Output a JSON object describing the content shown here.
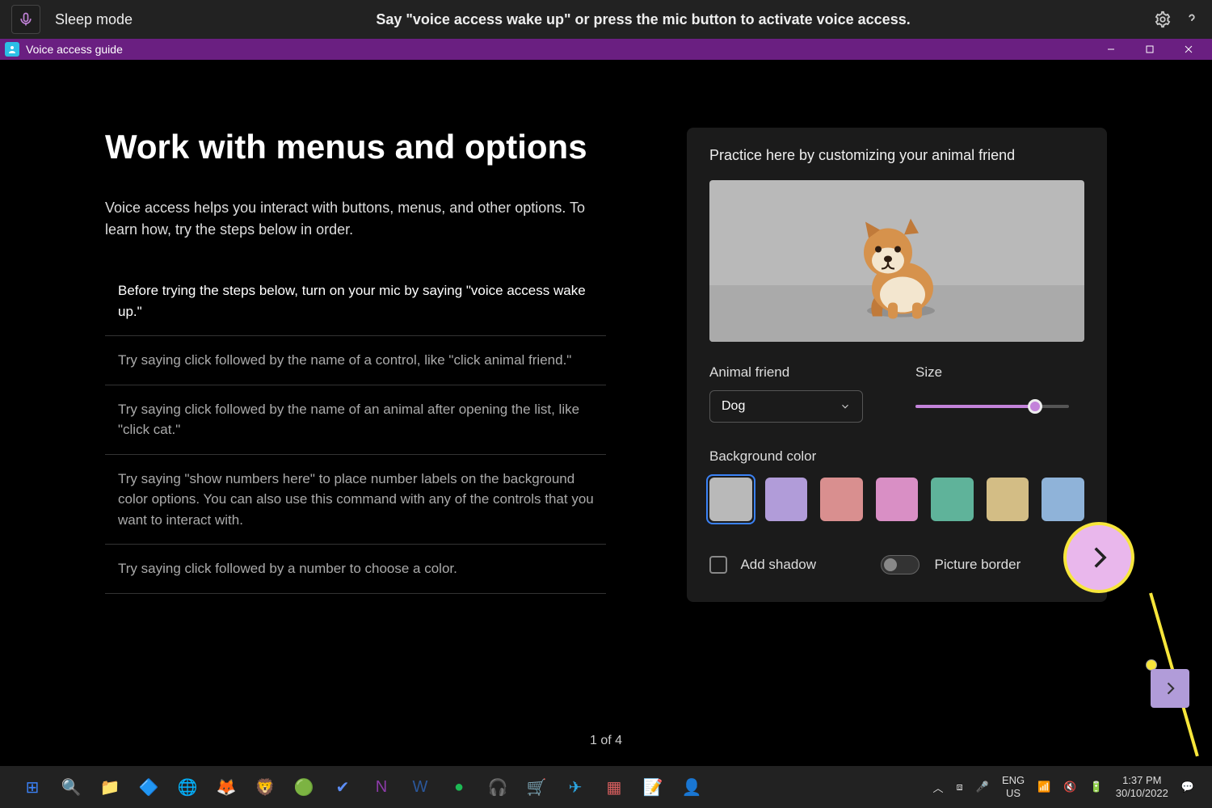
{
  "voice_access_bar": {
    "status": "Sleep mode",
    "instruction": "Say \"voice access wake up\" or press the mic button to activate voice access.",
    "icons": {
      "settings": "gear-icon",
      "help": "help-icon"
    }
  },
  "title_bar": {
    "app_icon": "voice-access-guide-icon",
    "title": "Voice access guide",
    "controls": {
      "minimize": "minimize",
      "maximize": "maximize",
      "close": "close"
    }
  },
  "guide": {
    "heading": "Work with menus and options",
    "intro": "Voice access helps you interact with buttons, menus, and other options. To learn how, try the steps below in order.",
    "steps": [
      "Before trying the steps below, turn on your mic by saying \"voice access wake up.\"",
      "Try saying click followed by the name of a control, like \"click animal friend.\"",
      "Try saying click followed by the name of an animal after opening the list, like \"click cat.\"",
      "Try saying \"show numbers here\" to place number labels on the background color options. You can also use this command with any of the controls that you want to interact with.",
      "Try saying click followed by a number to choose a color."
    ],
    "pager": "1 of 4"
  },
  "practice": {
    "title": "Practice here by customizing your animal friend",
    "animal_label": "Animal friend",
    "animal_value": "Dog",
    "size_label": "Size",
    "size_value_percent": 78,
    "bg_label": "Background color",
    "colors": [
      {
        "hex": "#b9b9b9",
        "selected": true
      },
      {
        "hex": "#b19cd9",
        "selected": false
      },
      {
        "hex": "#d98f8f",
        "selected": false
      },
      {
        "hex": "#d98fc5",
        "selected": false
      },
      {
        "hex": "#5fb39a",
        "selected": false
      },
      {
        "hex": "#d3bd85",
        "selected": false
      },
      {
        "hex": "#8fb3d9",
        "selected": false
      }
    ],
    "add_shadow_label": "Add shadow",
    "add_shadow_checked": false,
    "picture_border_label": "Picture border",
    "picture_border_on": false
  },
  "annotation": {
    "highlight": "next-page-button",
    "line_color": "#f7e63b"
  },
  "taskbar": {
    "apps": [
      {
        "name": "start-icon",
        "glyph": "⊞",
        "color": "#3b82f6"
      },
      {
        "name": "search-icon",
        "glyph": "🔍",
        "color": "#ddd"
      },
      {
        "name": "file-explorer-icon",
        "glyph": "📁",
        "color": "#f5c542"
      },
      {
        "name": "obsidian-icon",
        "glyph": "🔷",
        "color": "#7c5cd9"
      },
      {
        "name": "edge-icon",
        "glyph": "🌐",
        "color": "#3bb2e8"
      },
      {
        "name": "firefox-icon",
        "glyph": "🦊",
        "color": "#ff8a3b"
      },
      {
        "name": "brave-icon",
        "glyph": "🦁",
        "color": "#f0533b"
      },
      {
        "name": "chrome-icon",
        "glyph": "🟢",
        "color": "#4caf50"
      },
      {
        "name": "todo-icon",
        "glyph": "✔",
        "color": "#5c8df5"
      },
      {
        "name": "onenote-icon",
        "glyph": "N",
        "color": "#8c3ba8"
      },
      {
        "name": "word-icon",
        "glyph": "W",
        "color": "#2b579a"
      },
      {
        "name": "spotify-icon",
        "glyph": "●",
        "color": "#1db954"
      },
      {
        "name": "audacity-icon",
        "glyph": "🎧",
        "color": "#3b6fd9"
      },
      {
        "name": "kiosk-icon",
        "glyph": "🛒",
        "color": "#888"
      },
      {
        "name": "telegram-icon",
        "glyph": "✈",
        "color": "#2ca5e0"
      },
      {
        "name": "powertoys-icon",
        "glyph": "▦",
        "color": "#d95f5f"
      },
      {
        "name": "notepad-icon",
        "glyph": "📝",
        "color": "#8fb3d9"
      },
      {
        "name": "voice-access-icon",
        "glyph": "👤",
        "color": "#3bb2e8"
      }
    ],
    "tray": {
      "chevron": "chevron-up-icon",
      "dropbox": "dropbox-icon",
      "mic": "mic-icon",
      "lang1": "ENG",
      "lang2": "US",
      "wifi": "wifi-icon",
      "volume": "volume-mute-icon",
      "battery": "battery-icon",
      "time": "1:37 PM",
      "date": "30/10/2022",
      "notifications": "notifications-icon"
    }
  }
}
